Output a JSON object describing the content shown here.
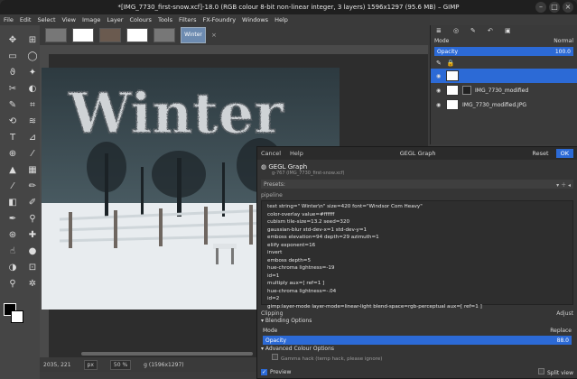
{
  "window_title": "*[IMG_7730_first-snow.xcf]-18.0 (RGB colour 8-bit non-linear integer, 3 layers) 1596x1297 (95.6 MB) – GIMP",
  "menu": [
    "File",
    "Edit",
    "Select",
    "View",
    "Image",
    "Layer",
    "Colours",
    "Tools",
    "Filters",
    "FX-Foundry",
    "Windows",
    "Help"
  ],
  "tab_active_label": "Winter",
  "canvas_text": "Winter",
  "status": {
    "coords": "2035, 221",
    "unit": "px",
    "zoom": "50 %",
    "info": "g (1596x1297)"
  },
  "layers_panel": {
    "mode_label": "Mode",
    "mode_value": "Normal",
    "opacity_label": "Opacity",
    "opacity_value": "100.0",
    "layers": [
      {
        "name": "",
        "selected": true
      },
      {
        "name": "IMG_7730_modified",
        "selected": false
      },
      {
        "name": "IMG_7730_modified.JPG",
        "selected": false
      }
    ]
  },
  "gegl": {
    "cancel": "Cancel",
    "help": "Help",
    "title": "GEGL Graph",
    "reset": "Reset",
    "ok": "OK",
    "subtitle": "g-767 (IMG_7730_first-snow.xcf)",
    "presets_label": "Presets:",
    "pipeline_label": "pipeline",
    "pipeline": [
      "text string=\" Winter\\n\" size=420 font=\"Windsor Com Heavy\"",
      "color-overlay value=#ffffff",
      "cubism tile-size=13.2 seed=320",
      "gaussian-blur std-dev-x=1 std-dev-y=1",
      "emboss elevation=94 depth=29 azimuth=1",
      "eliify exponent=16",
      "invert",
      "emboss depth=5",
      "hue-chroma lightness=-19",
      "id=1",
      "multiply aux=[ ref=1 ]",
      "hue-chroma lightness=-.04",
      "id=2",
      "gimp:layer-mode layer-mode=linear-light blend-space=rgb-perceptual aux=[ ref=1 ]"
    ],
    "clipping_label": "Clipping",
    "clipping_value": "Adjust",
    "blending_label": "Blending Options",
    "mode_label": "Mode",
    "mode_value": "Replace",
    "opacity_label": "Opacity",
    "opacity_value": "88.0",
    "advanced_label": "Advanced Colour Options",
    "gamma_label": "Gamma hack (temp hack, please ignore)",
    "preview_label": "Preview",
    "split_label": "Split view"
  }
}
